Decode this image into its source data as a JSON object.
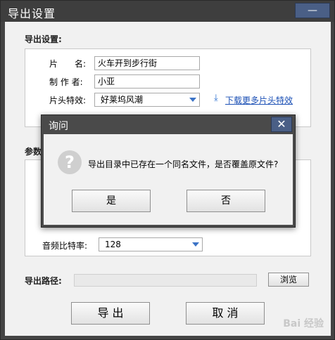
{
  "window": {
    "title": "导出设置",
    "close_glyph": "—"
  },
  "export_settings": {
    "section_label": "导出设置:",
    "title_label": "片　　名:",
    "title_value": "火车开到步行街",
    "author_label": "制 作 者:",
    "author_value": "小亚",
    "intro_effect_label": "片头特效:",
    "intro_effect_value": "好莱坞风潮",
    "more_effects_link": "下载更多片头特效"
  },
  "params": {
    "section_label": "参数",
    "audio_bitrate_label": "音频比特率:",
    "audio_bitrate_value": "128"
  },
  "export_path": {
    "label": "导出路径:",
    "value": "",
    "browse_label": "浏览"
  },
  "actions": {
    "export_label": "导 出",
    "cancel_label": "取 消"
  },
  "dialog": {
    "title": "询问",
    "close_glyph": "✕",
    "message": "导出目录中已存在一个同名文件，是否覆盖原文件?",
    "yes_label": "是",
    "no_label": "否"
  },
  "watermark": {
    "text": "Bai 经验"
  },
  "colors": {
    "title_bar": "#3e3e3e",
    "close_button": "#4a5f86",
    "link": "#1a4fb5",
    "dropdown_arrow": "#3b73c6"
  }
}
